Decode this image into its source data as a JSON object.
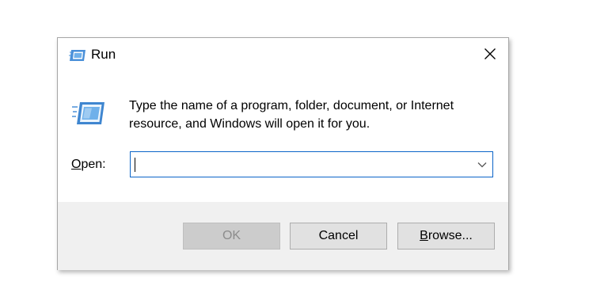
{
  "window": {
    "title": "Run",
    "title_icon": "run-icon",
    "close_icon": "close-icon"
  },
  "message": "Type the name of a program, folder, document, or Internet resource, and Windows will open it for you.",
  "open_field": {
    "label_mnemonic": "O",
    "label_rest": "pen:",
    "value": "",
    "dropdown_icon": "chevron-down-icon"
  },
  "buttons": {
    "ok": "OK",
    "cancel": "Cancel",
    "browse_mnemonic": "B",
    "browse_rest": "rowse..."
  },
  "colors": {
    "focus_border": "#0a64c8",
    "footer_bg": "#f0f0f0",
    "button_bg": "#e1e1e1",
    "disabled_text": "#8c8c8c"
  }
}
